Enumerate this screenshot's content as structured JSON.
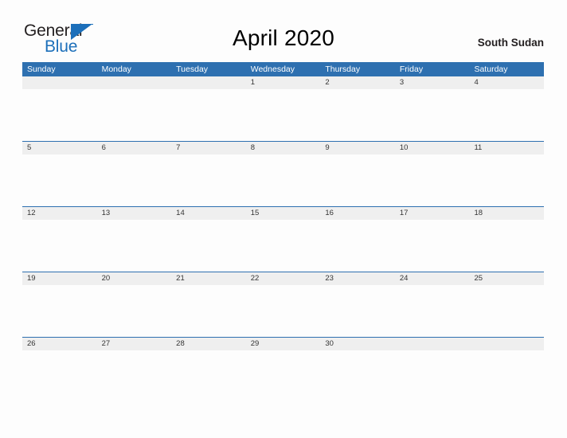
{
  "logo": {
    "word_one": "General",
    "word_two": "Blue",
    "icon": "blue-triangle-icon",
    "color_dark": "#231f20",
    "color_blue": "#1c6fba"
  },
  "header": {
    "title": "April 2020",
    "region": "South Sudan"
  },
  "theme": {
    "header_blue": "#2e70b0",
    "date_strip_gray": "#efefef",
    "cell_white": "#fdfdfd",
    "rule_blue": "#2e70b0",
    "text_dark": "#333333"
  },
  "calendar": {
    "day_headers": [
      "Sunday",
      "Monday",
      "Tuesday",
      "Wednesday",
      "Thursday",
      "Friday",
      "Saturday"
    ],
    "weeks": [
      {
        "rule": false,
        "days": [
          "",
          "",
          "",
          "1",
          "2",
          "3",
          "4"
        ]
      },
      {
        "rule": true,
        "days": [
          "5",
          "6",
          "7",
          "8",
          "9",
          "10",
          "11"
        ]
      },
      {
        "rule": true,
        "days": [
          "12",
          "13",
          "14",
          "15",
          "16",
          "17",
          "18"
        ]
      },
      {
        "rule": true,
        "days": [
          "19",
          "20",
          "21",
          "22",
          "23",
          "24",
          "25"
        ]
      },
      {
        "rule": true,
        "days": [
          "26",
          "27",
          "28",
          "29",
          "30",
          "",
          ""
        ]
      }
    ]
  }
}
